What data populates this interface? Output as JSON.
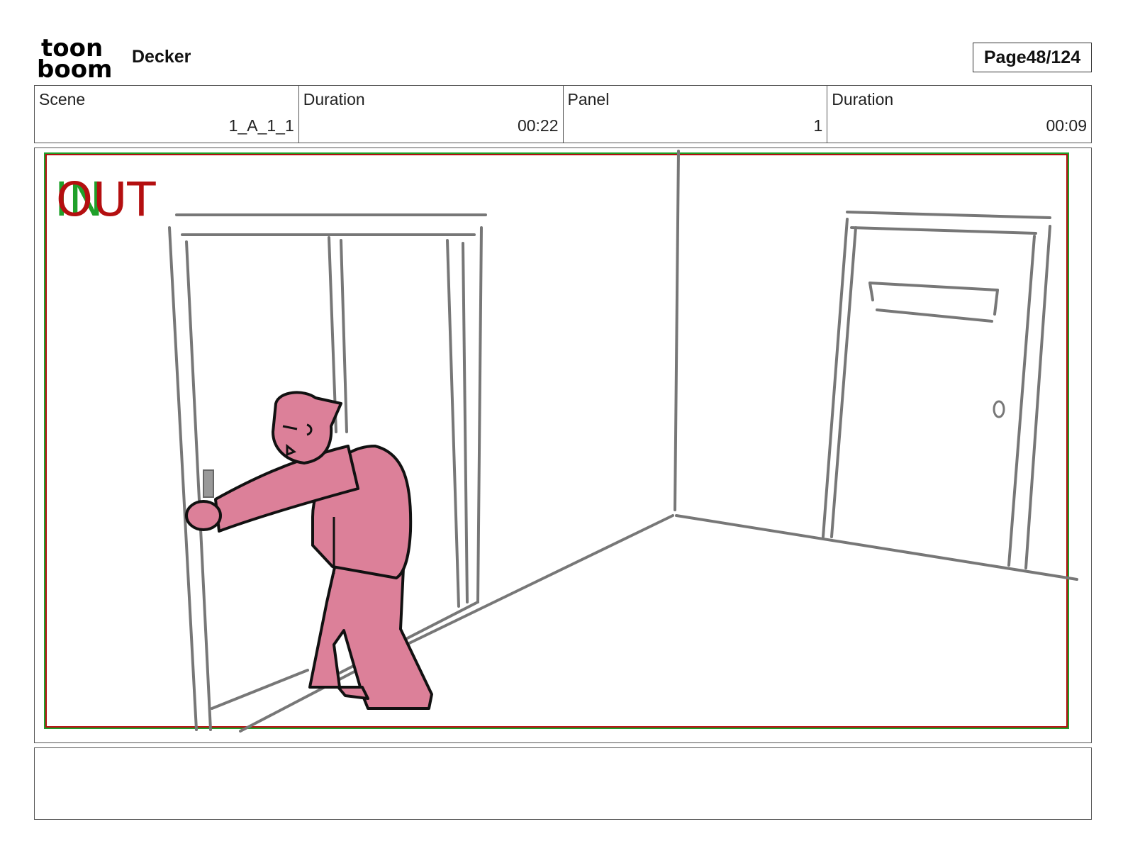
{
  "header": {
    "logo": {
      "line1": "toon",
      "line2": "boom",
      "icon": "toon-boom-logo"
    },
    "project_title": "Decker",
    "page_label": "Page",
    "page_number": "48/124"
  },
  "info": {
    "scene_label": "Scene",
    "scene_value": "1_A_1_1",
    "scene_duration_label": "Duration",
    "scene_duration_value": "00:22",
    "panel_label": "Panel",
    "panel_value": "1",
    "panel_duration_label": "Duration",
    "panel_duration_value": "00:09"
  },
  "panel": {
    "in_marker": "IN",
    "out_marker": "OUT",
    "colors": {
      "in_marker": "#1fa02a",
      "out_marker": "#b40f10",
      "character_fill": "#dc8099",
      "sketch_line": "#777777",
      "outline": "#111111"
    }
  },
  "notes": {
    "text": ""
  }
}
